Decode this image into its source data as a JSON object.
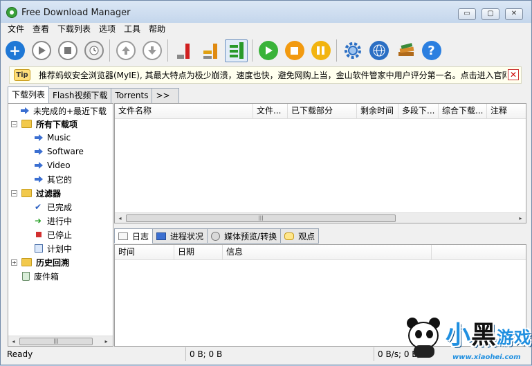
{
  "window": {
    "title": "Free Download Manager",
    "controls": {
      "minimize": "▭",
      "restore": "▢",
      "close": "✕"
    }
  },
  "menu": [
    "文件",
    "查看",
    "下载列表",
    "选项",
    "工具",
    "帮助"
  ],
  "toolbar": {
    "buttons": [
      {
        "icon": "add-download-icon",
        "color": "#1f78d6"
      },
      {
        "icon": "start-icon",
        "color": "#8a8a8a"
      },
      {
        "icon": "stop-icon",
        "color": "#8a8a8a"
      },
      {
        "icon": "scheduler-clock-icon",
        "color": "#8a8a8a"
      },
      {
        "icon": "move-up-icon",
        "color": "#9a9a9a"
      },
      {
        "icon": "move-down-icon",
        "color": "#9a9a9a"
      },
      {
        "icon": "traffic-low-icon",
        "color": "#d02020"
      },
      {
        "icon": "traffic-medium-icon",
        "color": "#e08a10"
      },
      {
        "icon": "traffic-high-icon",
        "color": "#2a9a2a"
      },
      {
        "icon": "start-all-icon",
        "color": "#3ab33a"
      },
      {
        "icon": "stop-all-icon",
        "color": "#f29a10"
      },
      {
        "icon": "pause-all-icon",
        "color": "#f2b410"
      },
      {
        "icon": "settings-gear-icon",
        "color": "#2b6fc4"
      },
      {
        "icon": "site-manager-globe-icon",
        "color": "#2b6fc4"
      },
      {
        "icon": "books-icon",
        "color": "#b06a1a"
      },
      {
        "icon": "help-icon",
        "color": "#2b7fe0"
      }
    ],
    "help_glyph": "?"
  },
  "tip": {
    "badge": "Tip",
    "text": "推荐蚂蚁安全浏览器(MyIE), 其最大特点为极少崩溃，速度也快，避免网购上当，金山软件管家中用户评分第一名。点击进入官网",
    "close": "✕"
  },
  "tabs": [
    "下载列表",
    "Flash视频下载",
    "Torrents",
    ">>"
  ],
  "tree": {
    "recent": "未完成的+最近下载",
    "all_downloads": "所有下载项",
    "categories": [
      "Music",
      "Software",
      "Video",
      "其它的"
    ],
    "filters": "过滤器",
    "filter_items": [
      "已完成",
      "进行中",
      "已停止",
      "计划中"
    ],
    "history": "历史回溯",
    "trash": "废件箱",
    "toggle_minus": "−",
    "toggle_plus": "+"
  },
  "download_columns": [
    "文件名称",
    "文件...",
    "已下载部分",
    "剩余时间",
    "多段下...",
    "综合下载...",
    "注释"
  ],
  "bottom_tabs": [
    "日志",
    "进程状况",
    "媒体预览/转换",
    "观点"
  ],
  "log_columns": [
    "时间",
    "日期",
    "信息"
  ],
  "status": {
    "ready": "Ready",
    "bytes": "0 B; 0 B",
    "speed": "0 B/s; 0 B/s"
  },
  "scroll": {
    "left": "◂",
    "right": "▸",
    "grip": "|||"
  },
  "watermark": {
    "text_black": "小",
    "text_blue": "黑",
    "text_game": "游戏",
    "url": "www.xiaohei.com"
  }
}
